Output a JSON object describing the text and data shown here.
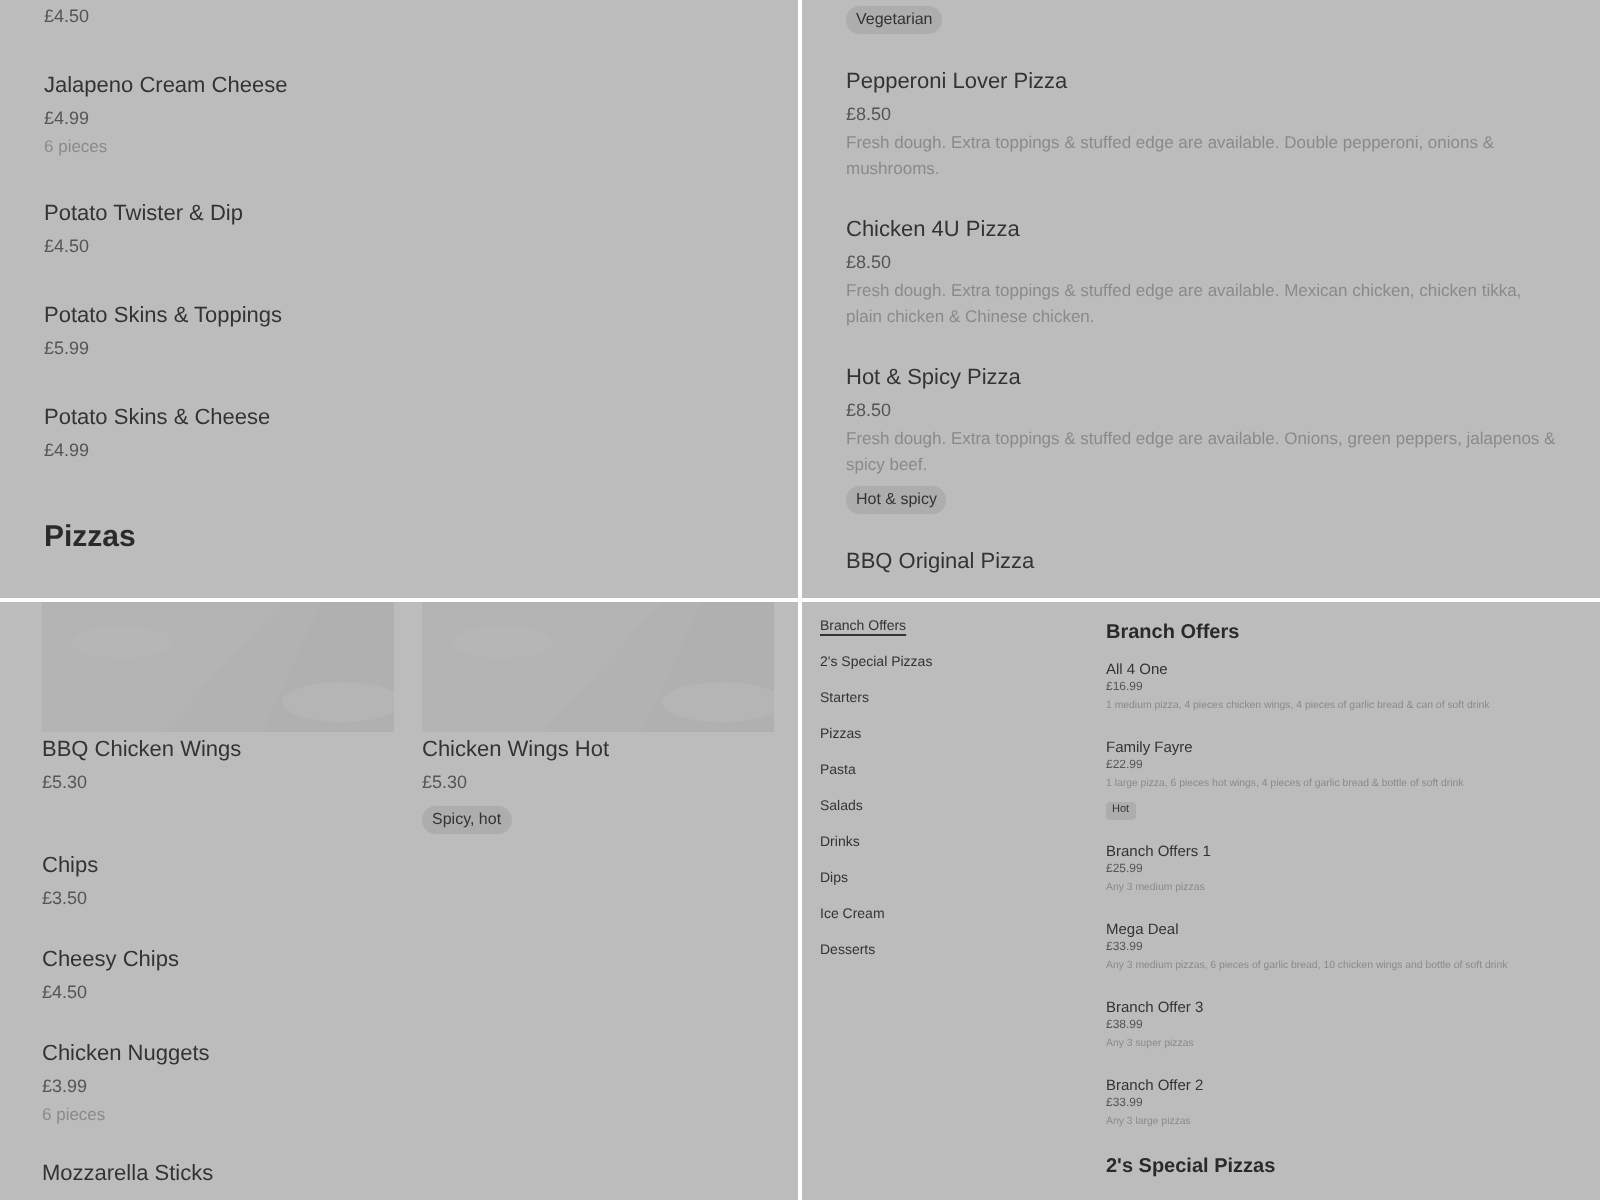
{
  "panels": [
    {
      "kind": "list",
      "items": [
        {
          "kind": "item",
          "price": "£4.50"
        },
        {
          "kind": "item",
          "name": "Jalapeno Cream Cheese",
          "price": "£4.99",
          "note": "6 pieces"
        },
        {
          "kind": "item",
          "name": "Potato Twister & Dip",
          "price": "£4.50"
        },
        {
          "kind": "item",
          "name": "Potato Skins & Toppings",
          "price": "£5.99"
        },
        {
          "kind": "item",
          "name": "Potato Skins & Cheese",
          "price": "£4.99"
        },
        {
          "kind": "heading",
          "name": "Pizzas"
        }
      ]
    },
    {
      "kind": "list",
      "items": [
        {
          "kind": "item",
          "tags": [
            "Vegetarian"
          ]
        },
        {
          "kind": "item",
          "name": "Pepperoni Lover Pizza",
          "price": "£8.50",
          "note": "Fresh dough. Extra toppings & stuffed edge are available. Double pepperoni, onions & mushrooms."
        },
        {
          "kind": "item",
          "name": "Chicken 4U Pizza",
          "price": "£8.50",
          "note": "Fresh dough. Extra toppings & stuffed edge are available. Mexican chicken, chicken tikka, plain chicken & Chinese chicken."
        },
        {
          "kind": "item",
          "name": "Hot & Spicy Pizza",
          "price": "£8.50",
          "note": "Fresh dough. Extra toppings & stuffed edge are available. Onions, green peppers, jalapenos & spicy beef.",
          "tags": [
            "Hot & spicy"
          ]
        },
        {
          "kind": "item",
          "name": "BBQ Original Pizza"
        }
      ]
    },
    {
      "kind": "cards",
      "cards": [
        {
          "kind": "picture",
          "name": "BBQ Chicken Wings",
          "price": "£5.30"
        },
        {
          "kind": "picture",
          "name": "Chicken Wings Hot",
          "price": "£5.30",
          "tags": [
            "Spicy, hot"
          ]
        }
      ],
      "items": [
        {
          "kind": "item",
          "name": "Chips",
          "price": "£3.50"
        },
        {
          "kind": "item",
          "name": "Cheesy Chips",
          "price": "£4.50"
        },
        {
          "kind": "item",
          "name": "Chicken Nuggets",
          "price": "£3.99",
          "note": "6 pieces"
        },
        {
          "kind": "item",
          "name": "Mozzarella Sticks"
        }
      ]
    },
    {
      "kind": "menu",
      "nav": [
        {
          "label": "Branch Offers",
          "selected": true
        },
        {
          "label": "2's Special Pizzas",
          "selected": false
        },
        {
          "label": "Starters",
          "selected": false
        },
        {
          "label": "Pizzas",
          "selected": false
        },
        {
          "label": "Pasta",
          "selected": false
        },
        {
          "label": "Salads",
          "selected": false
        },
        {
          "label": "Drinks",
          "selected": false
        },
        {
          "label": "Dips",
          "selected": false
        },
        {
          "label": "Ice Cream",
          "selected": false
        },
        {
          "label": "Desserts",
          "selected": false
        }
      ],
      "items": [
        {
          "kind": "heading",
          "name": "Branch Offers"
        },
        {
          "kind": "item",
          "name": "All 4 One",
          "price": "£16.99",
          "note": "1 medium pizza, 4 pieces chicken wings, 4 pieces of garlic bread & can of soft drink"
        },
        {
          "kind": "item",
          "name": "Family Fayre",
          "price": "£22.99",
          "note": "1 large pizza, 6 pieces hot wings, 4 pieces of garlic bread & bottle of soft drink",
          "tags": [
            "Hot"
          ]
        },
        {
          "kind": "item",
          "name": "Branch Offers 1",
          "price": "£25.99",
          "note": "Any 3 medium pizzas"
        },
        {
          "kind": "item",
          "name": "Mega Deal",
          "price": "£33.99",
          "note": "Any 3 medium pizzas, 6 pieces of garlic bread, 10 chicken wings and bottle of soft drink"
        },
        {
          "kind": "item",
          "name": "Branch Offer 3",
          "price": "£38.99",
          "note": "Any 3 super pizzas"
        },
        {
          "kind": "item",
          "name": "Branch Offer 2",
          "price": "£33.99",
          "note": "Any 3 large pizzas"
        },
        {
          "kind": "heading",
          "name": "2's Special Pizzas"
        }
      ]
    }
  ]
}
